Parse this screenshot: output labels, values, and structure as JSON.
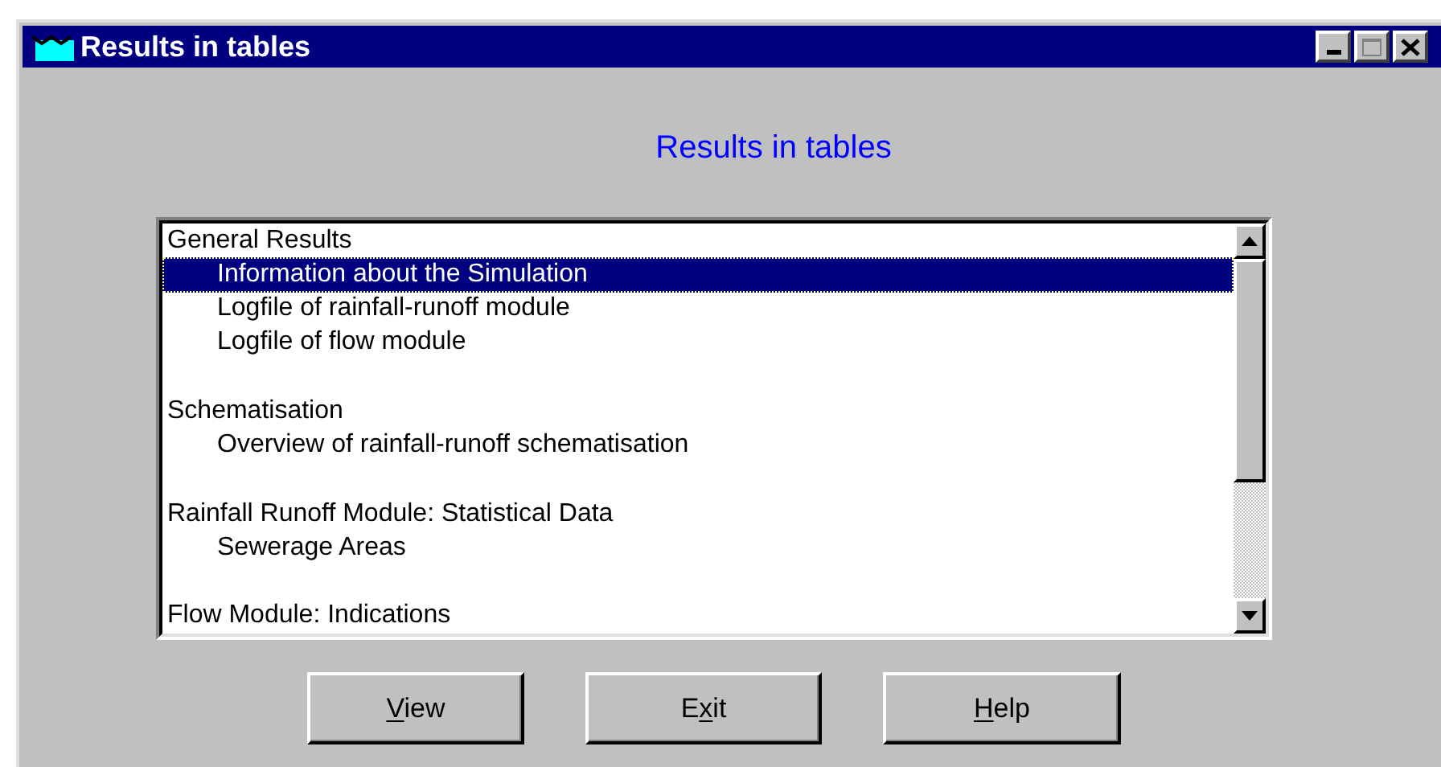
{
  "window": {
    "title": "Results in tables"
  },
  "heading": "Results in tables",
  "list": {
    "items": [
      {
        "kind": "header",
        "text": "General Results",
        "selected": false
      },
      {
        "kind": "child",
        "text": "Information about the Simulation",
        "selected": true
      },
      {
        "kind": "child",
        "text": "Logfile of rainfall-runoff module",
        "selected": false
      },
      {
        "kind": "child",
        "text": "Logfile of flow module",
        "selected": false
      },
      {
        "kind": "spacer"
      },
      {
        "kind": "header",
        "text": "Schematisation",
        "selected": false
      },
      {
        "kind": "child",
        "text": "Overview of rainfall-runoff schematisation",
        "selected": false
      },
      {
        "kind": "spacer"
      },
      {
        "kind": "header",
        "text": "Rainfall Runoff Module: Statistical Data",
        "selected": false
      },
      {
        "kind": "child",
        "text": "Sewerage Areas",
        "selected": false
      },
      {
        "kind": "spacer"
      },
      {
        "kind": "header",
        "text": "Flow Module: Indications",
        "selected": false
      }
    ]
  },
  "buttons": [
    {
      "key": "V",
      "after": "iew"
    },
    {
      "before": "E",
      "key": "x",
      "after": "it"
    },
    {
      "key": "H",
      "after": "elp"
    }
  ]
}
